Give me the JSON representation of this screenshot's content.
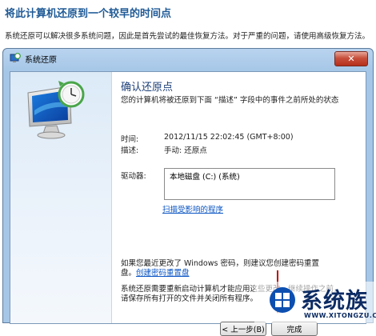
{
  "page": {
    "heading": "将此计算机还原到一个较早的时间点",
    "description": "系统还原可以解决很多系统问题，因此是首先尝试的最佳恢复方法。对于严重的问题，请使用高级恢复方法。"
  },
  "window": {
    "title": "系统还原",
    "close_label": "✕"
  },
  "dialog": {
    "heading": "确认还原点",
    "subtext": "您的计算机将被还原到下面 “描述” 字段中的事件之前所处的状态",
    "time_label": "时间:",
    "time_value": "2012/11/15 22:02:45 (GMT+8:00)",
    "desc_label": "描述:",
    "desc_value": "手动: 还原点",
    "drive_label": "驱动器:",
    "drives": [
      "本地磁盘 (C:) (系统)"
    ],
    "scan_link": "扫描受影响的程序",
    "password_note_prefix": "如果您最近更改了 Windows 密码，则建议您创建密码重置盘。",
    "password_note_link": "创建密码重置盘",
    "restart_note": "系统还原需要重新启动计算机才能应用这些更改。继续操作之前，请保存所有打开的文件并关闭所有程序。",
    "back_button": "< 上一步(B)",
    "finish_button": "完成"
  },
  "watermark": {
    "brand": "系统族",
    "url": "WWW.XITONGZU.COM",
    "brand_color": "#0c2b63"
  }
}
